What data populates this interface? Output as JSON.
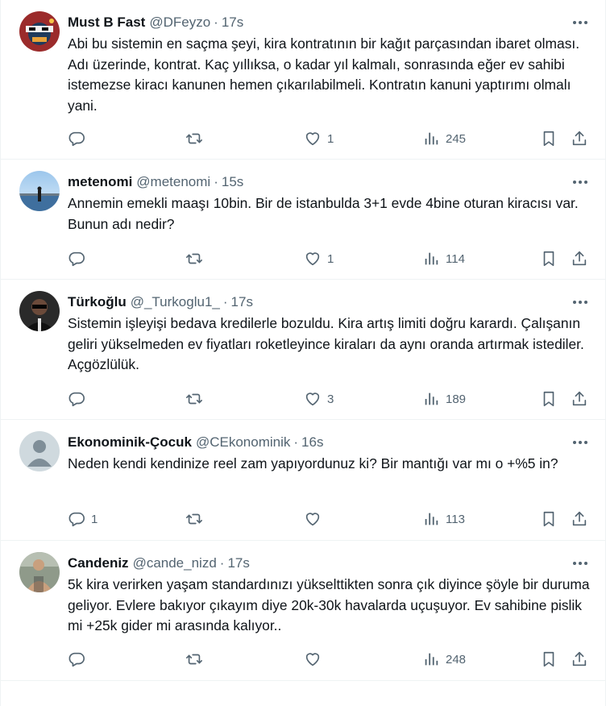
{
  "tweets": [
    {
      "name": "Must B Fast",
      "handle": "@DFeyzo",
      "sep": "·",
      "time": "17s",
      "text": "Abi bu sistemin en saçma şeyi, kira kontratının bir kağıt parçasından ibaret olması. Adı üzerinde, kontrat. Kaç yıllıksa, o kadar yıl kalmalı, sonrasında eğer ev sahibi istemezse kiracı kanunen hemen çıkarılabilmeli. Kontratın kanuni yaptırımı olmalı yani.",
      "replies": "",
      "retweets": "",
      "likes": "1",
      "views": "245"
    },
    {
      "name": "metenomi",
      "handle": "@metenomi",
      "sep": "·",
      "time": "15s",
      "text": "Annemin emekli maaşı 10bin. Bir de istanbulda 3+1 evde 4bine oturan kiracısı var. Bunun adı nedir?",
      "replies": "",
      "retweets": "",
      "likes": "1",
      "views": "114"
    },
    {
      "name": "Türkoğlu",
      "handle": "@_Turkoglu1_",
      "sep": "·",
      "time": "17s",
      "text": "Sistemin işleyişi bedava kredilerle bozuldu. Kira artış limiti doğru karardı. Çalışanın geliri yükselmeden ev fiyatları roketleyince kiraları da aynı oranda artırmak istediler. Açgözlülük.",
      "replies": "",
      "retweets": "",
      "likes": "3",
      "views": "189"
    },
    {
      "name": "Ekonominik-Çocuk",
      "handle": "@CEkonominik",
      "sep": "·",
      "time": "16s",
      "text": "Neden kendi kendinize reel zam yapıyordunuz ki? Bir mantığı var mı o +%5 in?",
      "replies": "1",
      "retweets": "",
      "likes": "",
      "views": "113"
    },
    {
      "name": "Candeniz",
      "handle": "@cande_nizd",
      "sep": "·",
      "time": "17s",
      "text": "5k kira verirken yaşam standardınızı yükselttikten sonra çık diyince şöyle bir duruma geliyor. Evlere bakıyor çıkayım diye 20k-30k havalarda uçuşuyor. Ev sahibine pislik mi +25k gider mi arasında kalıyor..",
      "replies": "",
      "retweets": "",
      "likes": "",
      "views": "248"
    }
  ],
  "icons": {
    "reply": "reply-icon",
    "retweet": "retweet-icon",
    "like": "heart-icon",
    "views": "views-chart-icon",
    "bookmark": "bookmark-icon",
    "share": "share-icon",
    "more": "more-dots-icon"
  },
  "colors": {
    "text": "#0f1419",
    "secondary": "#536471",
    "divider": "#eff3f4"
  }
}
